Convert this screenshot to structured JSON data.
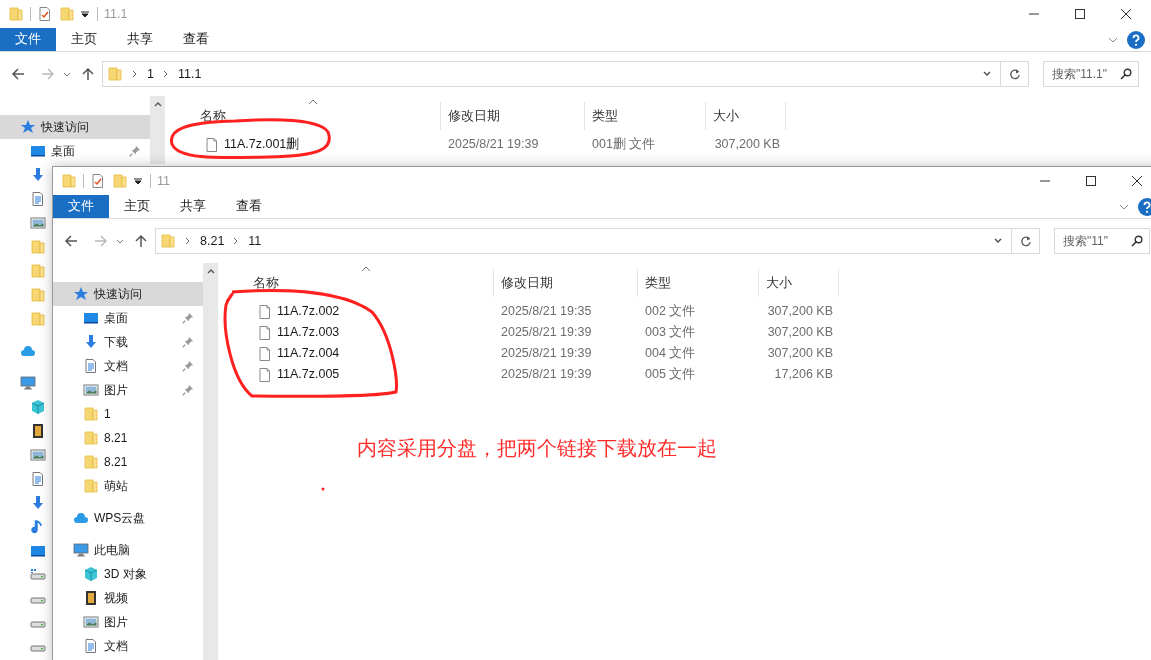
{
  "back_window": {
    "title": "11.1",
    "ribbon_tabs": [
      {
        "label": "文件",
        "selected": true
      },
      {
        "label": "主页",
        "selected": false
      },
      {
        "label": "共享",
        "selected": false
      },
      {
        "label": "查看",
        "selected": false
      }
    ],
    "path": [
      "1",
      "11.1"
    ],
    "search": {
      "placeholder": "搜索\"11.1\""
    },
    "sidebar": [
      {
        "label": "快速访问",
        "kind": "star",
        "selected": true,
        "pinned": false,
        "children": [
          {
            "label": "桌面",
            "kind": "desktop",
            "selected": false,
            "pinned": true
          },
          {
            "kind": "download",
            "selected": false
          },
          {
            "kind": "document",
            "selected": false
          },
          {
            "kind": "picture",
            "selected": false
          },
          {
            "kind": "folder",
            "selected": false
          },
          {
            "kind": "folder",
            "selected": false
          },
          {
            "kind": "folder",
            "selected": false
          },
          {
            "kind": "folder",
            "selected": false
          }
        ]
      },
      {
        "kind": "cloud",
        "selected": false
      },
      {
        "kind": "pc",
        "selected": false,
        "children": [
          {
            "kind": "cube",
            "selected": false
          },
          {
            "kind": "video",
            "selected": false
          },
          {
            "kind": "picture",
            "selected": false
          },
          {
            "kind": "document",
            "selected": false
          },
          {
            "kind": "download",
            "selected": false
          },
          {
            "kind": "music",
            "selected": false
          },
          {
            "kind": "desktop",
            "selected": false
          },
          {
            "kind": "drive-windows",
            "selected": false
          },
          {
            "kind": "drive",
            "selected": false
          },
          {
            "kind": "drive",
            "selected": false
          },
          {
            "kind": "drive",
            "selected": false
          }
        ]
      }
    ],
    "columns": [
      "名称",
      "修改日期",
      "类型",
      "大小"
    ],
    "files": [
      {
        "name": "11A.7z.001删",
        "date": "2025/8/21 19:39",
        "type": "001删 文件",
        "size": "307,200 KB"
      }
    ]
  },
  "front_window": {
    "title": "11",
    "ribbon_tabs": [
      {
        "label": "文件",
        "selected": true
      },
      {
        "label": "主页",
        "selected": false
      },
      {
        "label": "共享",
        "selected": false
      },
      {
        "label": "查看",
        "selected": false
      }
    ],
    "path": [
      "8.21",
      "11"
    ],
    "search": {
      "placeholder": "搜索\"11\""
    },
    "sidebar": [
      {
        "label": "快速访问",
        "kind": "star",
        "selected": true,
        "pinned": false,
        "children": [
          {
            "label": "桌面",
            "kind": "desktop",
            "selected": false,
            "pinned": true
          },
          {
            "label": "下载",
            "kind": "download",
            "selected": false,
            "pinned": true
          },
          {
            "label": "文档",
            "kind": "document",
            "selected": false,
            "pinned": true
          },
          {
            "label": "图片",
            "kind": "picture",
            "selected": false,
            "pinned": true
          },
          {
            "label": "1",
            "kind": "folder",
            "selected": false,
            "pinned": false
          },
          {
            "label": "8.21",
            "kind": "folder",
            "selected": false,
            "pinned": false
          },
          {
            "label": "8.21",
            "kind": "folder",
            "selected": false,
            "pinned": false
          },
          {
            "label": "萌站",
            "kind": "folder",
            "selected": false,
            "pinned": false
          }
        ]
      },
      {
        "label": "WPS云盘",
        "kind": "cloud",
        "selected": false,
        "pinned": false
      },
      {
        "label": "此电脑",
        "kind": "pc",
        "selected": false,
        "pinned": false,
        "children": [
          {
            "label": "3D 对象",
            "kind": "cube",
            "selected": false,
            "pinned": false
          },
          {
            "label": "视频",
            "kind": "video",
            "selected": false,
            "pinned": false
          },
          {
            "label": "图片",
            "kind": "picture",
            "selected": false,
            "pinned": false
          },
          {
            "label": "文档",
            "kind": "document",
            "selected": false,
            "pinned": false
          }
        ]
      }
    ],
    "columns": [
      "名称",
      "修改日期",
      "类型",
      "大小"
    ],
    "files": [
      {
        "name": "11A.7z.002",
        "date": "2025/8/21 19:35",
        "type": "002 文件",
        "size": "307,200 KB"
      },
      {
        "name": "11A.7z.003",
        "date": "2025/8/21 19:39",
        "type": "003 文件",
        "size": "307,200 KB"
      },
      {
        "name": "11A.7z.004",
        "date": "2025/8/21 19:39",
        "type": "004 文件",
        "size": "307,200 KB"
      },
      {
        "name": "11A.7z.005",
        "date": "2025/8/21 19:39",
        "type": "005 文件",
        "size": "17,206 KB"
      }
    ]
  },
  "annotation": {
    "note": "内容采用分盘，把两个链接下载放在一起"
  }
}
